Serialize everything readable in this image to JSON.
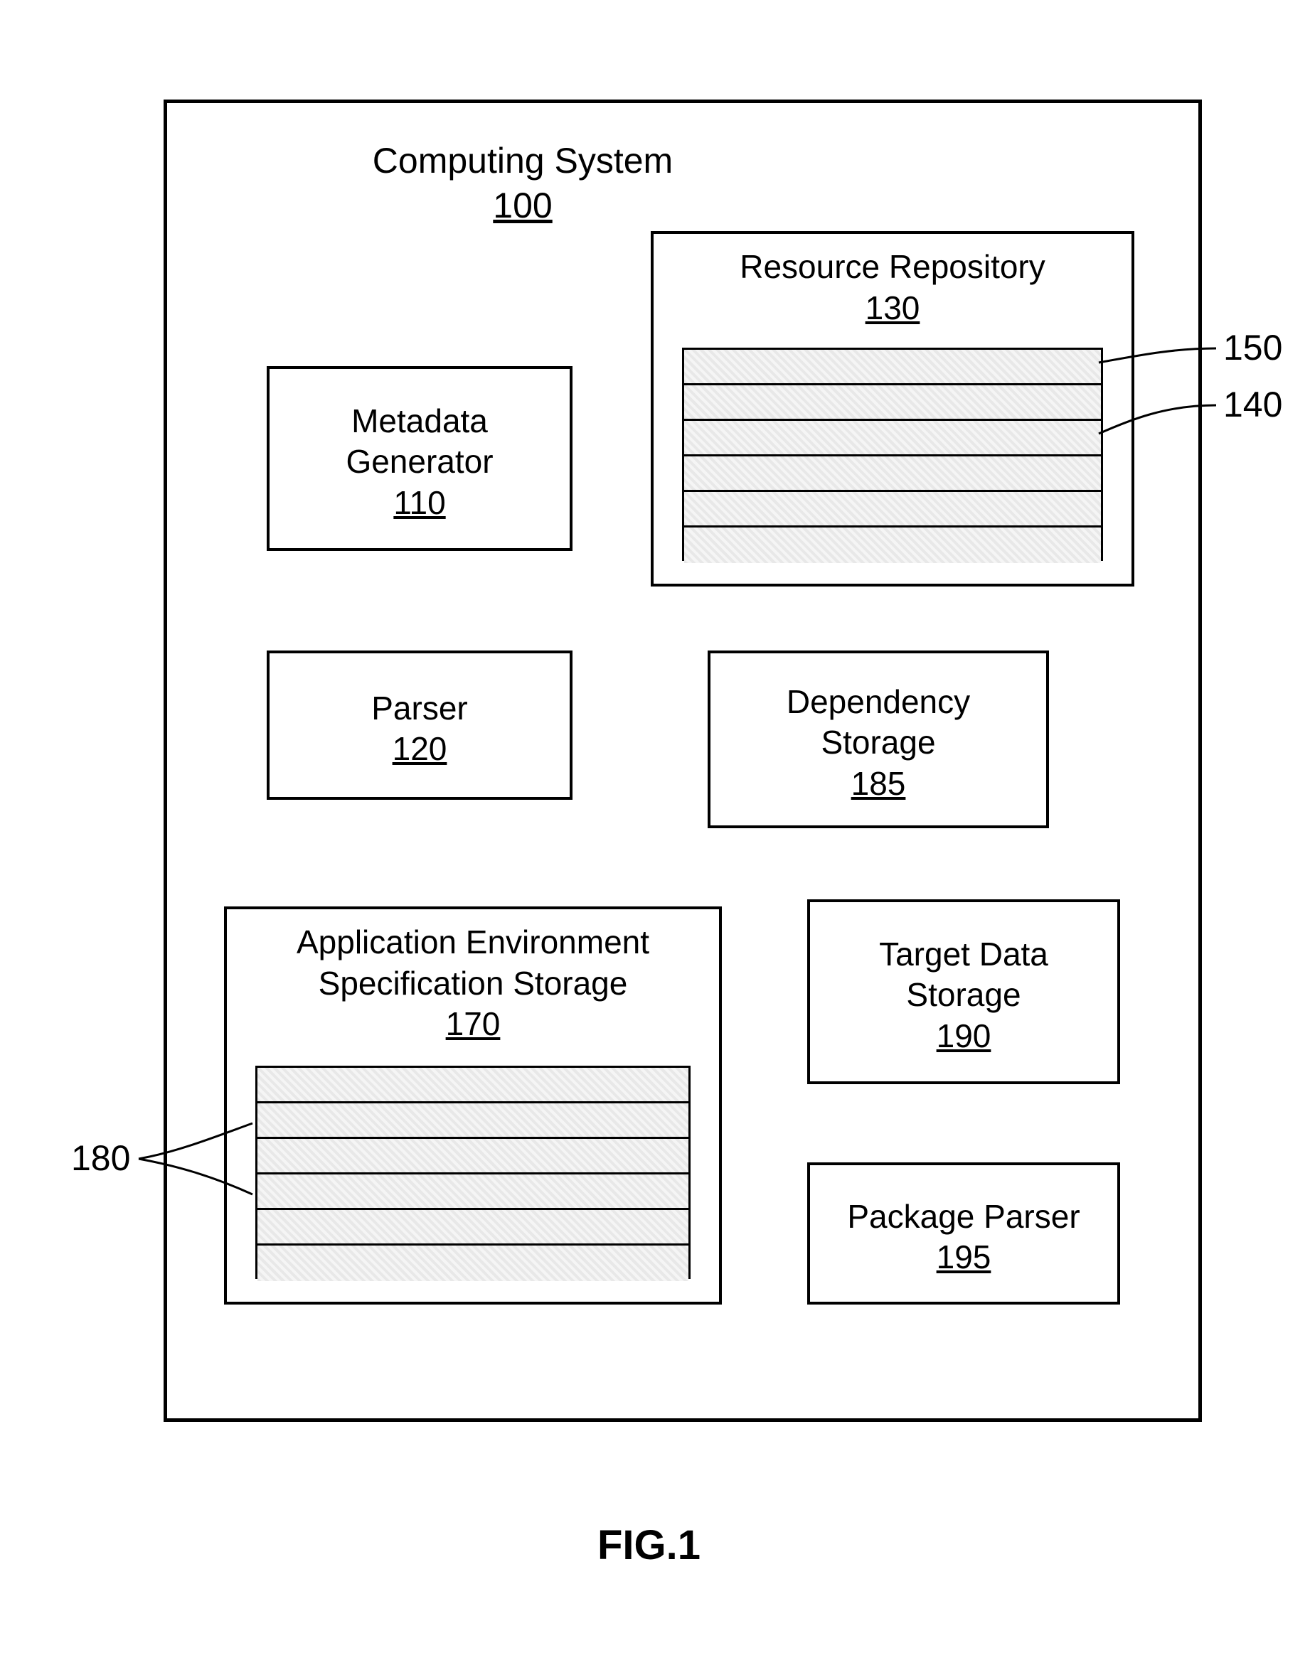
{
  "figure_caption": "FIG.1",
  "system": {
    "title": "Computing System",
    "ref": "100"
  },
  "components": {
    "metadata_generator": {
      "label": "Metadata\nGenerator",
      "ref": "110"
    },
    "parser": {
      "label": "Parser",
      "ref": "120"
    },
    "resource_repository": {
      "label": "Resource Repository",
      "ref": "130"
    },
    "dependency_storage": {
      "label": "Dependency\nStorage",
      "ref": "185"
    },
    "app_env_spec_storage": {
      "label": "Application Environment\nSpecification Storage",
      "ref": "170"
    },
    "target_data_storage": {
      "label": "Target Data\nStorage",
      "ref": "190"
    },
    "package_parser": {
      "label": "Package Parser",
      "ref": "195"
    }
  },
  "callouts": {
    "c150": "150",
    "c140": "140",
    "c180": "180"
  }
}
